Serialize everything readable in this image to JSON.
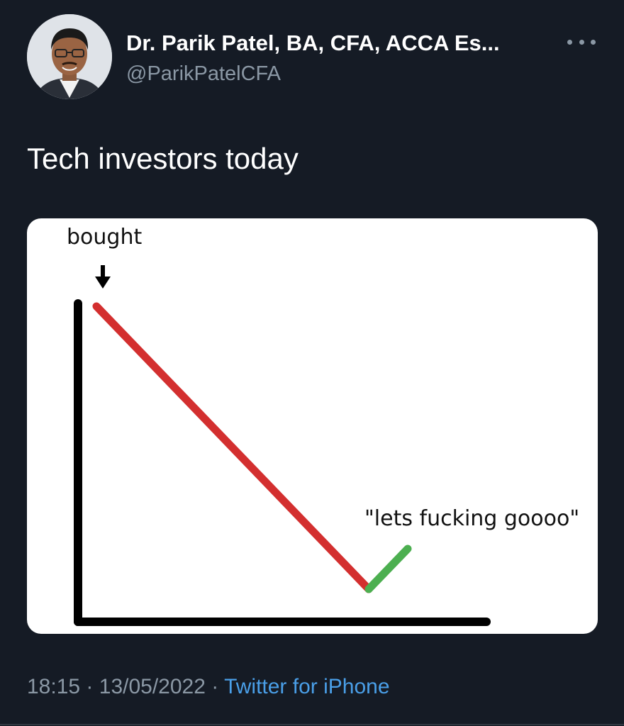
{
  "author": {
    "display_name": "Dr. Parik Patel, BA, CFA, ACCA Es...",
    "handle": "@ParikPatelCFA"
  },
  "tweet": {
    "text": "Tech investors today",
    "time": "18:15",
    "separator": "·",
    "date": "13/05/2022",
    "source": "Twitter for iPhone"
  },
  "media": {
    "label_bought": "bought",
    "label_goooo": "\"lets fucking goooo\"",
    "colors": {
      "decline": "#d32f2f",
      "rebound": "#4caf50",
      "axes": "#000000"
    }
  },
  "icons": {
    "more": "more-options-icon",
    "arrow": "down-arrow-icon"
  }
}
